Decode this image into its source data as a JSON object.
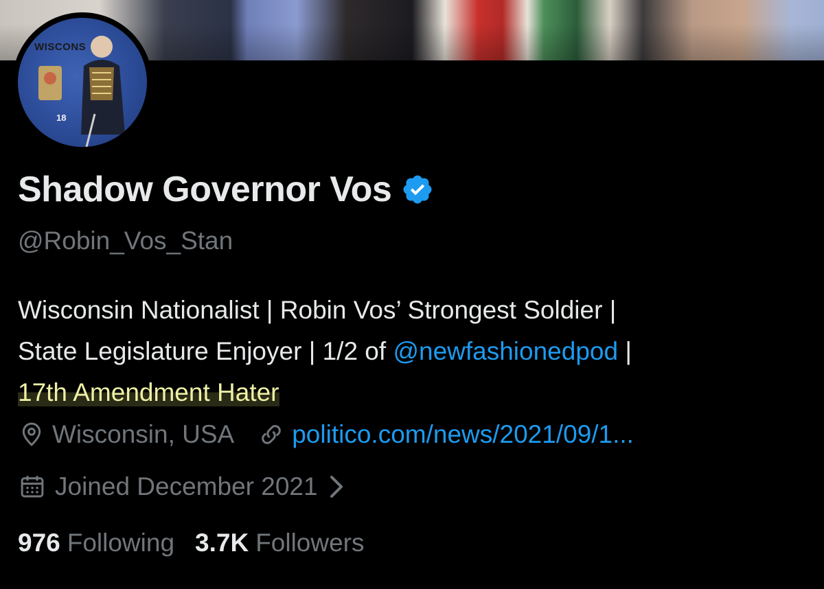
{
  "profile": {
    "avatar_text_state": "WISCONS",
    "avatar_text_year": "18",
    "display_name": "Shadow Governor Vos",
    "handle": "@Robin_Vos_Stan",
    "bio": {
      "line1": "Wisconsin Nationalist | Robin Vos’ Strongest Soldier |",
      "line2_prefix": "State Legislature Enjoyer | 1/2 of ",
      "line2_link": "@newfashionedpod",
      "line2_suffix": " |",
      "line3": "17th Amendment Hater"
    },
    "location": "Wisconsin, USA",
    "website": "politico.com/news/2021/09/1...",
    "joined": "Joined December 2021",
    "following_count": "976",
    "following_label": "Following",
    "followers_count": "3.7K",
    "followers_label": "Followers"
  },
  "icons": {
    "verified": "verified-badge-icon",
    "location": "location-pin-icon",
    "link": "link-icon",
    "calendar": "calendar-icon",
    "chevron": "chevron-right-icon"
  },
  "colors": {
    "background": "#000000",
    "text_primary": "#e7e9ea",
    "text_secondary": "#71767b",
    "link": "#1d9bf0",
    "verified": "#1d9bf0",
    "highlight": "#eef0a6"
  }
}
